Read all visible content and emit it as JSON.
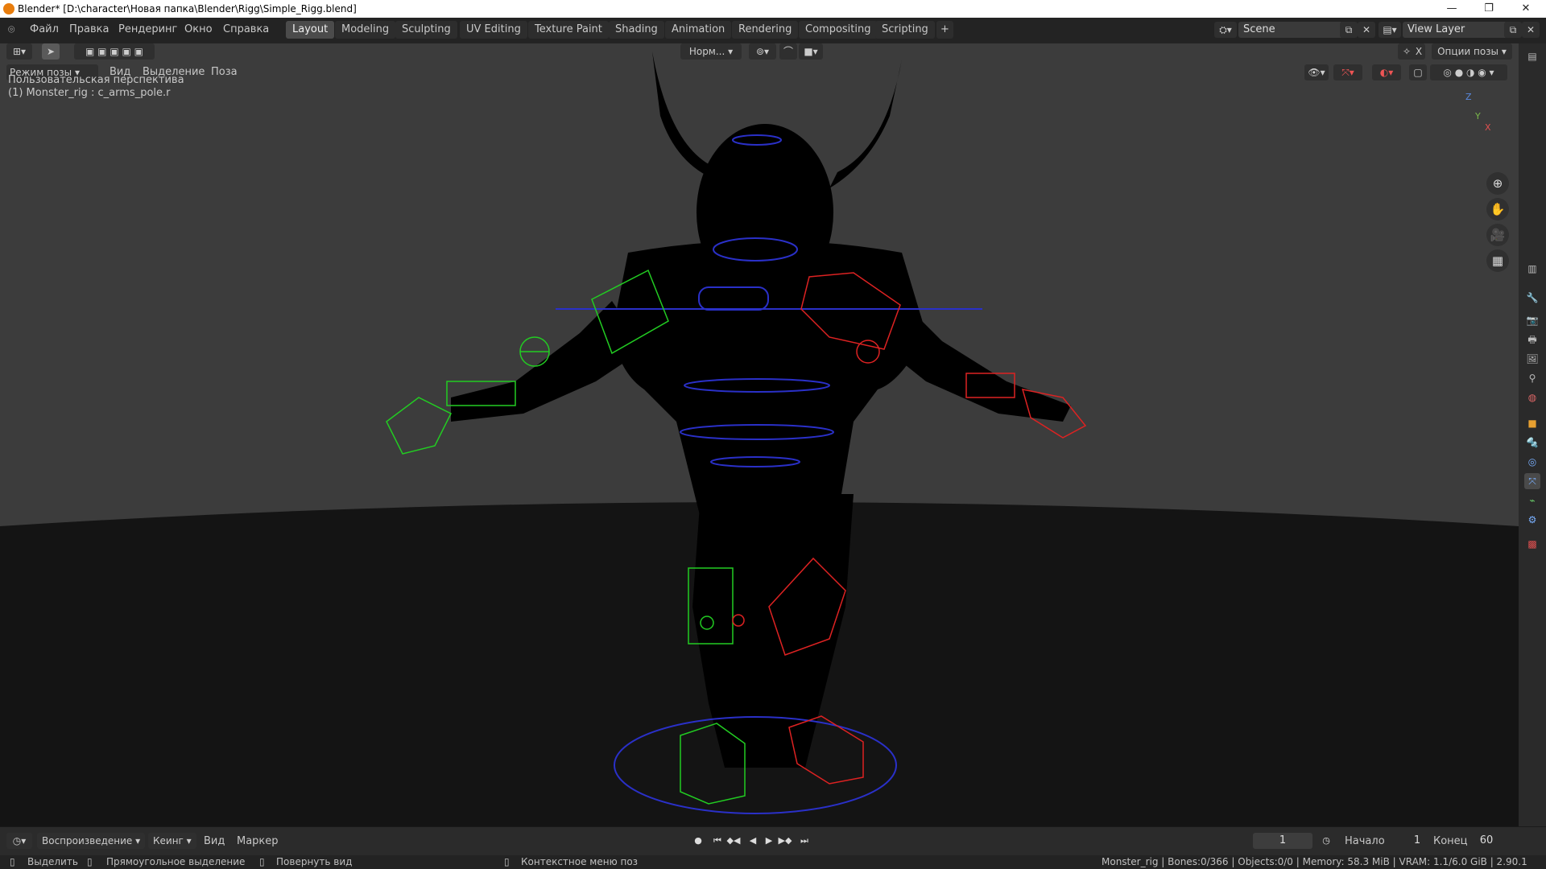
{
  "window": {
    "title": "Blender* [D:\\character\\Новая папка\\Blender\\Rigg\\Simple_Rigg.blend]",
    "controls": [
      "—",
      "❐",
      "✕"
    ]
  },
  "menu": [
    "Файл",
    "Правка",
    "Рендеринг",
    "Окно",
    "Справка"
  ],
  "workspaces": [
    "Layout",
    "Modeling",
    "Sculpting",
    "UV Editing",
    "Texture Paint",
    "Shading",
    "Animation",
    "Rendering",
    "Compositing",
    "Scripting",
    "+"
  ],
  "active_workspace": "Layout",
  "scene": {
    "name": "Scene",
    "view_layer": "View Layer"
  },
  "viewport": {
    "mode": "Режим позы",
    "menus": [
      "Вид",
      "Выделение",
      "Поза"
    ],
    "transform_orientation": "Норм...",
    "pose_options": "Опции позы",
    "overlay_line1": "Пользовательская перспектива",
    "overlay_line2": "(1) Monster_rig : c_arms_pole.r",
    "gizmo": {
      "x": "X",
      "y": "Y",
      "z": "Z"
    },
    "colors": {
      "background": "#3c3c3c",
      "floor": "#141414",
      "mesh": "#000000",
      "left_controls": "#22cc22",
      "right_controls": "#dd2222",
      "center_controls": "#2233cc"
    }
  },
  "timeline": {
    "playback": "Воспроизведение",
    "keying": "Кеинг",
    "view": "Вид",
    "marker": "Маркер",
    "current_frame": "1",
    "start_label": "Начало",
    "start": "1",
    "end_label": "Конец",
    "end": "60"
  },
  "statusbar": {
    "select": "Выделить",
    "box_select": "Прямоугольное выделение",
    "rotate_view": "Повернуть вид",
    "context_menu": "Контекстное меню поз",
    "stats": "Monster_rig | Bones:0/366 | Objects:0/0 | Memory: 58.3 MiB | VRAM: 1.1/6.0 GiB | 2.90.1"
  }
}
